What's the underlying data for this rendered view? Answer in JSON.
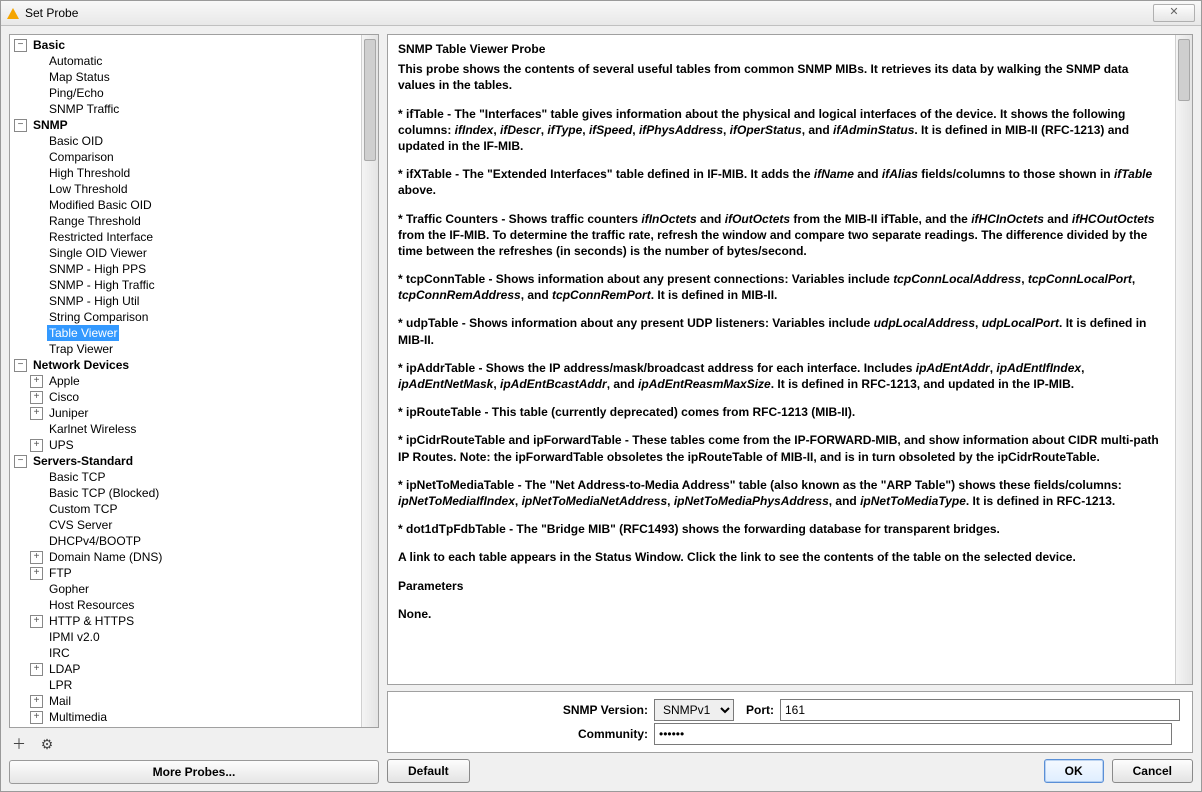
{
  "window": {
    "title": "Set Probe",
    "close_glyph": "✕"
  },
  "left": {
    "toolbar_plus": "＋",
    "toolbar_gear": "⚙",
    "more_probes": "More Probes...",
    "tree": [
      {
        "label": "Basic",
        "exp": "-",
        "children": [
          {
            "label": "Automatic"
          },
          {
            "label": "Map Status"
          },
          {
            "label": "Ping/Echo"
          },
          {
            "label": "SNMP Traffic"
          }
        ]
      },
      {
        "label": "SNMP",
        "exp": "-",
        "children": [
          {
            "label": "Basic OID"
          },
          {
            "label": "Comparison"
          },
          {
            "label": "High Threshold"
          },
          {
            "label": "Low Threshold"
          },
          {
            "label": "Modified Basic OID"
          },
          {
            "label": "Range Threshold"
          },
          {
            "label": "Restricted Interface"
          },
          {
            "label": "Single OID Viewer"
          },
          {
            "label": "SNMP - High PPS"
          },
          {
            "label": "SNMP - High Traffic"
          },
          {
            "label": "SNMP - High Util"
          },
          {
            "label": "String Comparison"
          },
          {
            "label": "Table Viewer",
            "selected": true
          },
          {
            "label": "Trap Viewer"
          }
        ]
      },
      {
        "label": "Network Devices",
        "exp": "-",
        "children": [
          {
            "label": "Apple",
            "exp": "+"
          },
          {
            "label": "Cisco",
            "exp": "+"
          },
          {
            "label": "Juniper",
            "exp": "+"
          },
          {
            "label": "Karlnet Wireless"
          },
          {
            "label": "UPS",
            "exp": "+"
          }
        ]
      },
      {
        "label": "Servers-Standard",
        "exp": "-",
        "children": [
          {
            "label": "Basic TCP"
          },
          {
            "label": "Basic TCP (Blocked)"
          },
          {
            "label": "Custom TCP"
          },
          {
            "label": "CVS Server"
          },
          {
            "label": "DHCPv4/BOOTP"
          },
          {
            "label": "Domain Name (DNS)",
            "exp": "+"
          },
          {
            "label": "FTP",
            "exp": "+"
          },
          {
            "label": "Gopher"
          },
          {
            "label": "Host Resources"
          },
          {
            "label": "HTTP & HTTPS",
            "exp": "+"
          },
          {
            "label": "IPMI v2.0"
          },
          {
            "label": "IRC"
          },
          {
            "label": "LDAP",
            "exp": "+"
          },
          {
            "label": "LPR"
          },
          {
            "label": "Mail",
            "exp": "+"
          },
          {
            "label": "Multimedia",
            "exp": "+"
          }
        ]
      }
    ]
  },
  "desc": {
    "title": "SNMP Table Viewer Probe",
    "p1": "This probe shows the contents of several useful tables from common SNMP MIBs. It retrieves its data by walking the SNMP data values in the tables.",
    "p2": "* ifTable - The \"Interfaces\" table gives information about the physical and logical interfaces of the device. It shows the following columns: <i>ifIndex</i>, <i>ifDescr</i>, <i>ifType</i>, <i>ifSpeed</i>, <i>ifPhysAddress</i>, <i>ifOperStatus</i>, and <i>ifAdminStatus</i>. It is defined in MIB-II (RFC-1213) and updated in the IF-MIB.",
    "p3": "* ifXTable - The \"Extended Interfaces\" table defined in IF-MIB. It adds the <i>ifName</i> and <i>ifAlias</i> fields/columns to those shown in <i>ifTable</i> above.",
    "p4": "* Traffic Counters - Shows traffic counters <i>ifInOctets</i> and <i>ifOutOctets</i> from the MIB-II ifTable, and the <i>ifHCInOctets</i> and <i>ifHCOutOctets</i> from the IF-MIB. To determine the traffic rate, refresh the window and compare two separate readings. The difference divided by the time between the refreshes (in seconds) is the number of bytes/second.",
    "p5": "* tcpConnTable - Shows information about any present connections: Variables include <i>tcpConnLocalAddress</i>, <i>tcpConnLocalPort</i>, <i>tcpConnRemAddress</i>, and <i>tcpConnRemPort</i>. It is defined in MIB-II.",
    "p6": "* udpTable - Shows information about any present UDP listeners: Variables include <i>udpLocalAddress</i>, <i>udpLocalPort</i>. It is defined in MIB-II.",
    "p7": "* ipAddrTable - Shows the IP address/mask/broadcast address for each interface. Includes <i>ipAdEntAddr</i>, <i>ipAdEntIfIndex</i>, <i>ipAdEntNetMask</i>, <i>ipAdEntBcastAddr</i>,  and <i>ipAdEntReasmMaxSize</i>. It is defined in RFC-1213, and updated in the IP-MIB.",
    "p8": "* ipRouteTable - This table (currently deprecated) comes from RFC-1213 (MIB-II).",
    "p9": "* ipCidrRouteTable and ipForwardTable - These tables come from the IP-FORWARD-MIB, and show information about CIDR multi-path IP Routes. Note: the ipForwardTable obsoletes the ipRouteTable of MIB-II, and is in turn obsoleted by the ipCidrRouteTable.",
    "p10": "* ipNetToMediaTable - The \"Net Address-to-Media Address\" table (also known as the \"ARP Table\") shows these fields/columns: <i>ipNetToMediaIfIndex</i>, <i>ipNetToMediaNetAddress</i>, <i>ipNetToMediaPhysAddress</i>, and <i>ipNetToMediaType</i>. It is defined in RFC-1213.",
    "p11": "* dot1dTpFdbTable - The \"Bridge MIB\" (RFC1493) shows the forwarding database for transparent bridges.",
    "p12": "A link to each table appears in the Status Window. Click the link to see the contents of the table on the selected device.",
    "p13": "Parameters",
    "p14": "None."
  },
  "params": {
    "version_label": "SNMP Version:",
    "version_value": "SNMPv1",
    "port_label": "Port:",
    "port_value": "161",
    "community_label": "Community:",
    "community_value": "••••••"
  },
  "buttons": {
    "default": "Default",
    "ok": "OK",
    "cancel": "Cancel"
  }
}
